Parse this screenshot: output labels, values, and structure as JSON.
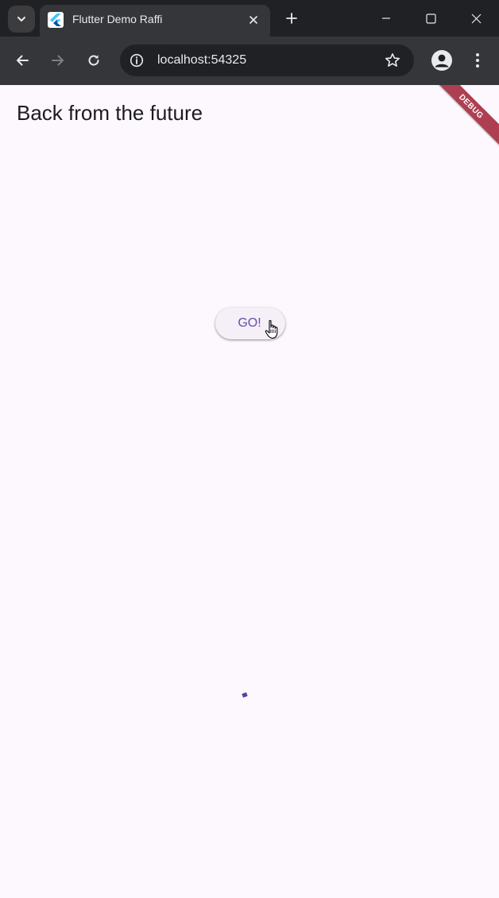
{
  "browser": {
    "tab": {
      "title": "Flutter Demo Raffi"
    },
    "address_bar": {
      "url": "localhost:54325"
    }
  },
  "page": {
    "heading": "Back from the future",
    "go_button_label": "GO!",
    "debug_banner": "DEBUG"
  },
  "icons": {
    "tab_search": "chevron-down-icon",
    "favicon": "flutter-logo-icon",
    "tab_close": "close-icon",
    "new_tab": "plus-icon",
    "minimize": "minimize-icon",
    "maximize": "maximize-icon",
    "window_close": "close-icon",
    "back": "arrow-left-icon",
    "forward": "arrow-right-icon",
    "reload": "reload-icon",
    "site_info": "info-icon",
    "bookmark": "star-icon",
    "profile": "person-icon",
    "menu": "kebab-menu-icon",
    "pointer": "hand-pointer-icon"
  },
  "colors": {
    "page_background": "#fdf8fd",
    "button_background": "#f5eff7",
    "button_text": "#6750a4",
    "progress_indicator": "#5e3fa6",
    "debug_banner": "#a01e32"
  }
}
